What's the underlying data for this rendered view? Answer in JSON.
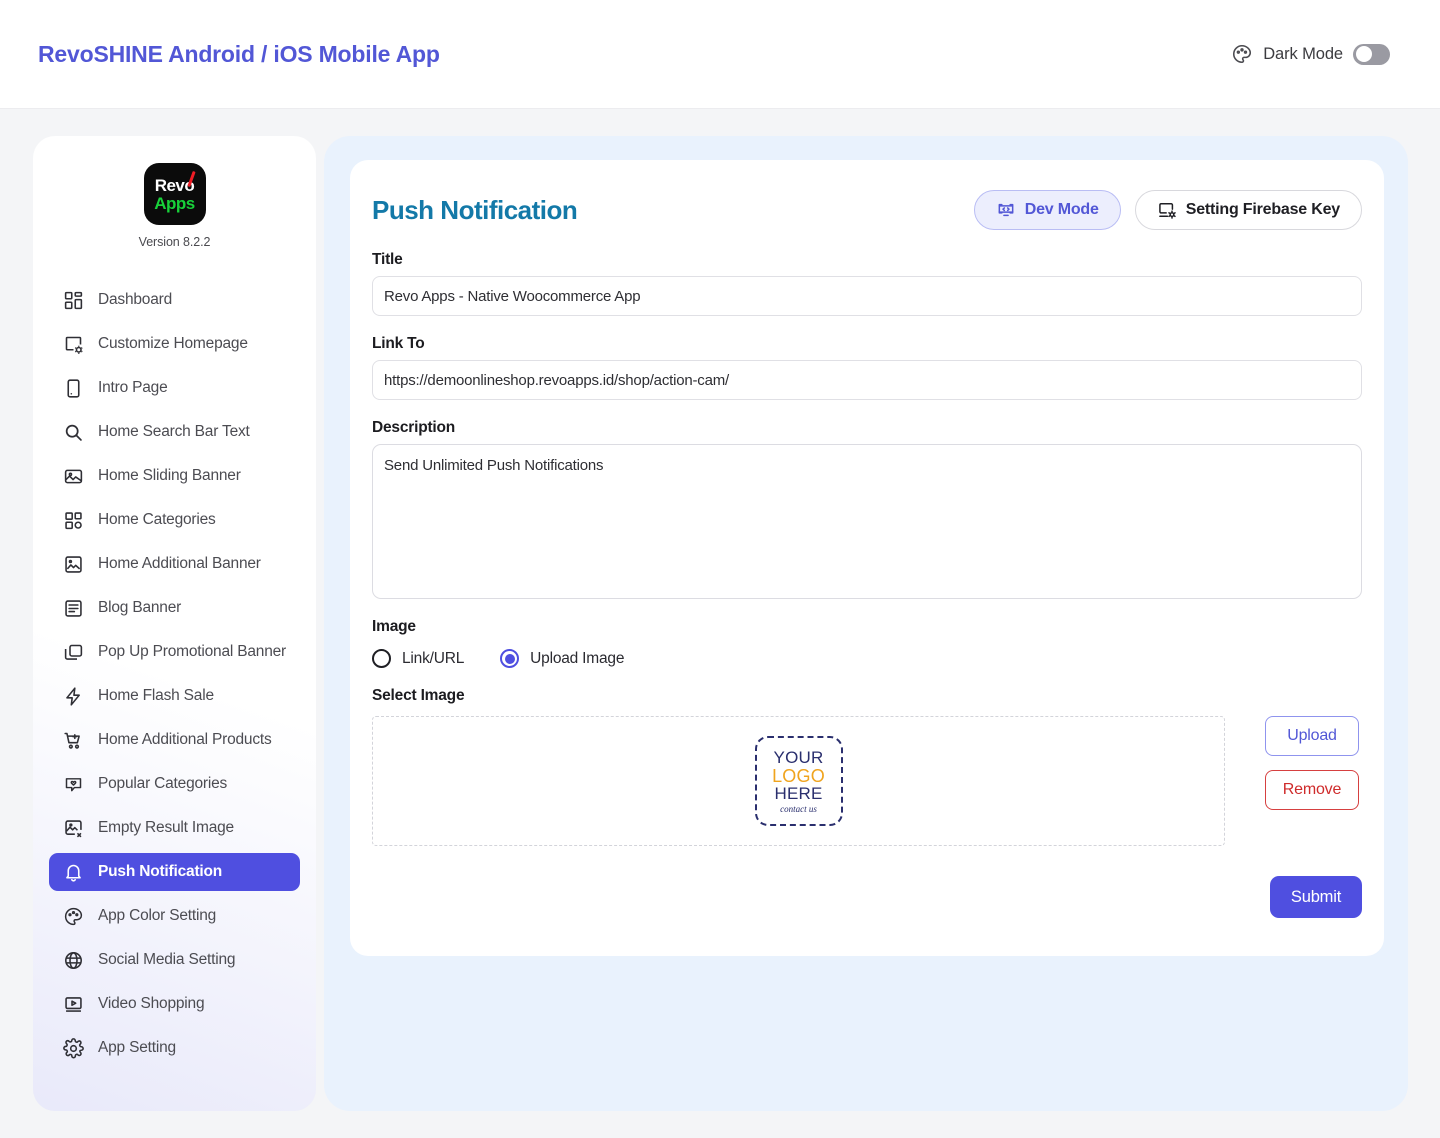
{
  "header": {
    "app_title": "RevoSHINE Android / iOS Mobile App",
    "dark_mode_label": "Dark Mode",
    "dark_mode_on": false,
    "palette_icon": "palette-icon"
  },
  "sidebar": {
    "logo_top": "Revo",
    "logo_bottom": "Apps",
    "version": "Version 8.2.2",
    "items": [
      {
        "label": "Dashboard",
        "icon": "grid-icon",
        "active": false
      },
      {
        "label": "Customize Homepage",
        "icon": "layout-settings-icon",
        "active": false
      },
      {
        "label": "Intro Page",
        "icon": "mobile-icon",
        "active": false
      },
      {
        "label": "Home Search Bar Text",
        "icon": "search-icon",
        "active": false
      },
      {
        "label": "Home Sliding Banner",
        "icon": "gallery-icon",
        "active": false
      },
      {
        "label": "Home Categories",
        "icon": "grid-dots-icon",
        "active": false
      },
      {
        "label": "Home Additional Banner",
        "icon": "image-icon",
        "active": false
      },
      {
        "label": "Blog Banner",
        "icon": "article-icon",
        "active": false
      },
      {
        "label": "Pop Up Promotional Banner",
        "icon": "windows-icon",
        "active": false
      },
      {
        "label": "Home Flash Sale",
        "icon": "bolt-icon",
        "active": false
      },
      {
        "label": "Home Additional Products",
        "icon": "cart-plus-icon",
        "active": false
      },
      {
        "label": "Popular Categories",
        "icon": "heart-bubble-icon",
        "active": false
      },
      {
        "label": "Empty Result Image",
        "icon": "image-off-icon",
        "active": false
      },
      {
        "label": "Push Notification",
        "icon": "bell-icon",
        "active": true
      },
      {
        "label": "App Color Setting",
        "icon": "palette-icon",
        "active": false
      },
      {
        "label": "Social Media Setting",
        "icon": "globe-icon",
        "active": false
      },
      {
        "label": "Video Shopping",
        "icon": "video-icon",
        "active": false
      },
      {
        "label": "App Setting",
        "icon": "gear-icon",
        "active": false
      }
    ]
  },
  "main": {
    "title": "Push Notification",
    "dev_mode_label": "Dev Mode",
    "dev_mode_icon": "dev-monitor-icon",
    "firebase_label": "Setting Firebase Key",
    "firebase_icon": "screen-settings-icon",
    "fields": {
      "title_label": "Title",
      "title_value": "Revo Apps - Native Woocommerce App",
      "link_label": "Link To",
      "link_value": "https://demoonlineshop.revoapps.id/shop/action-cam/",
      "description_label": "Description",
      "description_value": "Send Unlimited Push Notifications",
      "image_label": "Image",
      "select_image_label": "Select Image"
    },
    "image_options": [
      {
        "label": "Link/URL",
        "selected": false
      },
      {
        "label": "Upload Image",
        "selected": true
      }
    ],
    "placeholder_image": {
      "line1": "YOUR",
      "line2": "LOGO",
      "line3": "HERE",
      "line4": "contact us"
    },
    "upload_label": "Upload",
    "remove_label": "Remove",
    "submit_label": "Submit"
  },
  "colors": {
    "accent_indigo": "#4f4fe0",
    "title_purple": "#5257d6",
    "heading_teal": "#1379a8",
    "danger_red": "#cf2b2b",
    "panel_blue": "#e9f2fd",
    "logo_green": "#18d13a",
    "logo_red": "#ee1c25",
    "placeholder_navy": "#2a2f6e",
    "placeholder_orange": "#f0a41e"
  }
}
